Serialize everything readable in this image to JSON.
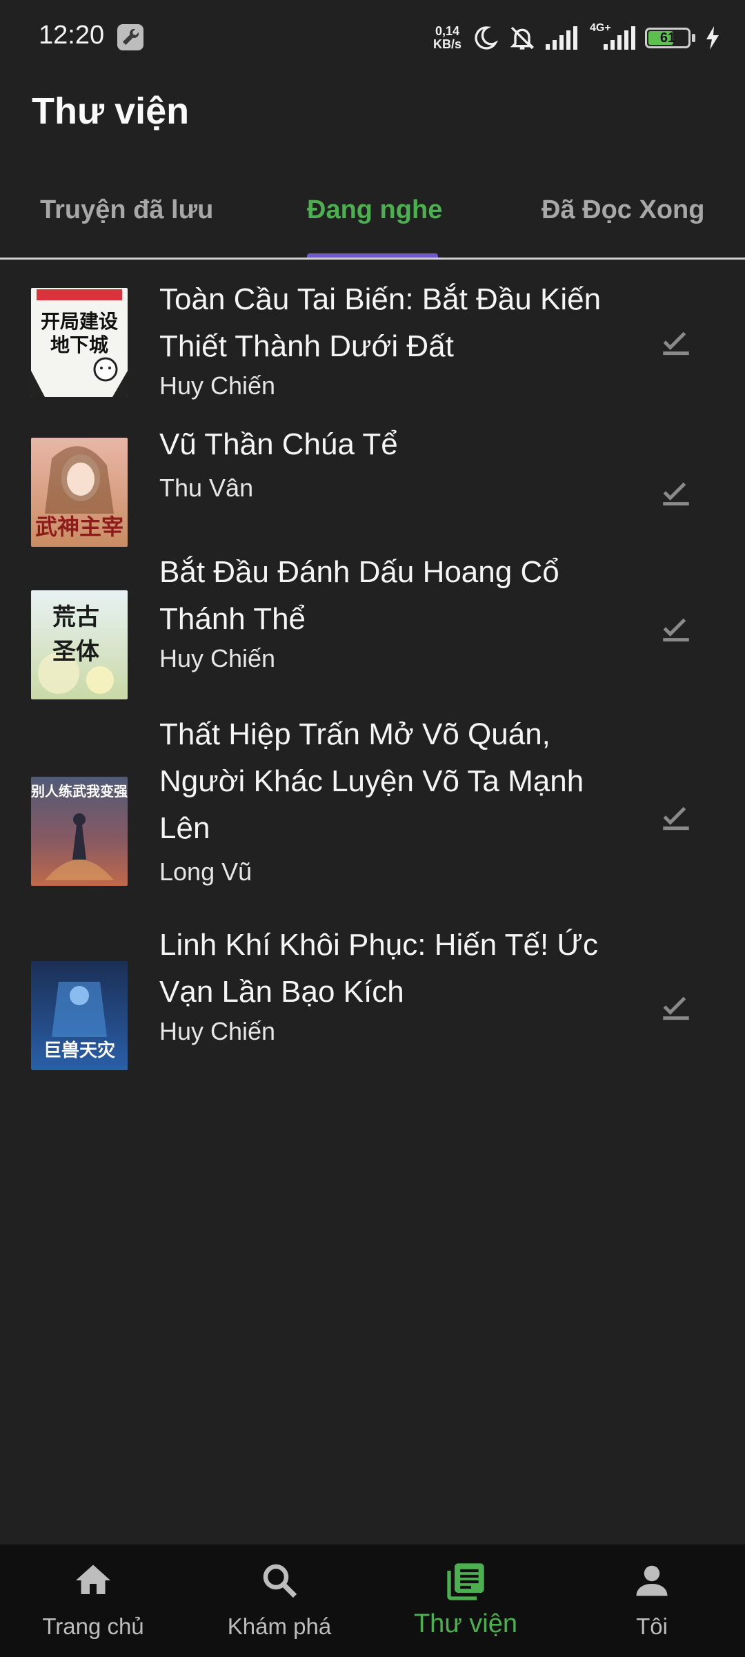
{
  "status_bar": {
    "time": "12:20",
    "net_speed_value": "0,14",
    "net_speed_unit": "KB/s",
    "network": "4G+",
    "battery": "61"
  },
  "header": {
    "title": "Thư viện"
  },
  "tabs": [
    {
      "label": "Truyện đã lưu",
      "active": false
    },
    {
      "label": "Đang nghe",
      "active": true
    },
    {
      "label": "Đã Đọc Xong",
      "active": false
    }
  ],
  "colors": {
    "accent": "#4caf50",
    "indicator": "#6e5acb",
    "background": "#212121",
    "nav_background": "#0f0f0f"
  },
  "books": [
    {
      "title": "Toàn Cầu Tai Biến: Bắt Đầu Kiến Thiết Thành Dưới Đất",
      "author": "Huy Chiến",
      "cover_text": "开局建设地下城"
    },
    {
      "title": "Vũ Thần Chúa Tể",
      "author": "Thu Vân",
      "cover_text": "武神主宰"
    },
    {
      "title": "Bắt Đầu Đánh Dấu Hoang Cổ Thánh Thể",
      "author": "Huy Chiến",
      "cover_text": "荒古圣体"
    },
    {
      "title": "Thất Hiệp Trấn Mở Võ Quán, Người Khác Luyện Võ Ta Mạnh Lên",
      "author": "Long Vũ",
      "cover_text": "别人练武我变强"
    },
    {
      "title": "Linh Khí Khôi Phục: Hiến Tế! Ức Vạn Lần Bạo Kích",
      "author": "Huy Chiến",
      "cover_text": "巨兽天灾"
    }
  ],
  "bottom_nav": [
    {
      "label": "Trang chủ",
      "icon": "home-icon",
      "active": false
    },
    {
      "label": "Khám phá",
      "icon": "search-icon",
      "active": false
    },
    {
      "label": "Thư viện",
      "icon": "library-icon",
      "active": true
    },
    {
      "label": "Tôi",
      "icon": "person-icon",
      "active": false
    }
  ]
}
